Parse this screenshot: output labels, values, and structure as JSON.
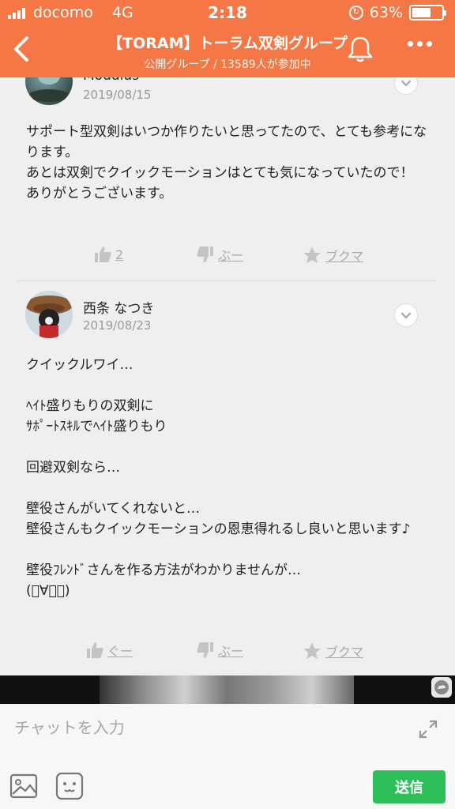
{
  "status_bar": {
    "carrier": "docomo",
    "network": "4G",
    "time": "2:18",
    "battery": "63%",
    "battery_level": 0.63
  },
  "header": {
    "title": "【TORAM】トーラム双剣グループ",
    "subtitle": "公開グループ / 13589人が参加中"
  },
  "posts": [
    {
      "author": "Modulus",
      "date": "2019/08/15",
      "body": "サポート型双剣はいつか作りたいと思ってたので、とても参考になります。\nあとは双剣でクイックモーションはとても気になっていたので！\nありがとうございます。",
      "like_label": "2",
      "boo_label": "ぶー",
      "bookmark_label": "ブクマ"
    },
    {
      "author": "西条 なつき",
      "date": "2019/08/23",
      "body": "クイックルワイ…\n\nﾍｲﾄ盛りもりの双剣に\nｻﾎﾟｰﾄｽｷﾙでﾍｲﾄ盛りもり\n\n回避双剣なら…\n\n壁役さんがいてくれないと…\n壁役さんもクイックモーションの恩恵得れるし良いと思います♪\n\n壁役ﾌﾚﾝﾄﾞさんを作る方法がわかりませんが…\n(ﾟ∀ﾟ。)",
      "like_label": "ぐー",
      "boo_label": "ぶー",
      "bookmark_label": "ブクマ"
    }
  ],
  "composer": {
    "placeholder": "チャットを入力",
    "send_label": "送信"
  },
  "colors": {
    "header_bg": "#f47745",
    "send_bg": "#2fbf5a"
  }
}
